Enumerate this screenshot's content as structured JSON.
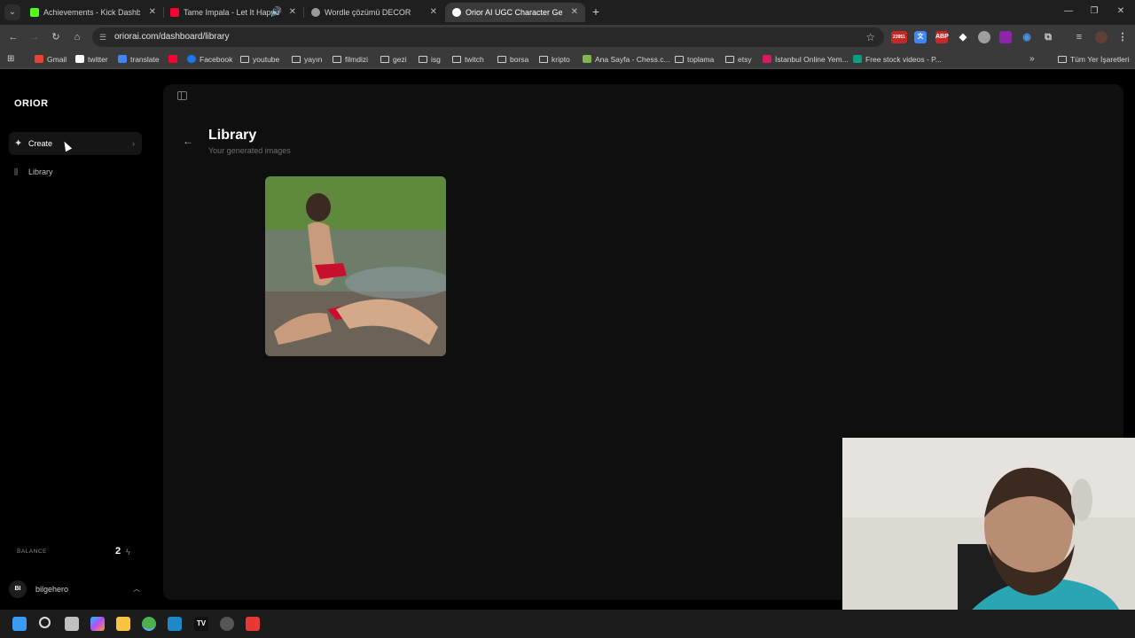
{
  "browser": {
    "tabs": [
      {
        "title": "Achievements - Kick Dashboard",
        "favicon_color": "#53fc18",
        "active": false
      },
      {
        "title": "Tame Impala - Let It Happen",
        "favicon_color": "#ff0033",
        "active": false
      },
      {
        "title": "Wordle çözümü DECOR",
        "favicon_color": "#9a9a9a",
        "active": false
      },
      {
        "title": "Orior AI UGC Character Generator",
        "favicon_color": "#ffffff",
        "active": true
      }
    ],
    "url": "oriorai.com/dashboard/library",
    "extension_badge": "23951",
    "extensions": [
      "red-badge-ext",
      "translate-ext",
      "abp-ext",
      "diamond-ext",
      "face-ext",
      "purple-ext",
      "speech-ext",
      "puzzle-ext"
    ],
    "bookmarks": [
      {
        "label": "Gmail",
        "icon": "gmail-icon",
        "color": "#ea4335"
      },
      {
        "label": "twitter",
        "icon": "x-icon",
        "color": "#ffffff"
      },
      {
        "label": "translate",
        "icon": "translate-icon",
        "color": "#4285f4"
      },
      {
        "label": "",
        "icon": "youtube-icon",
        "color": "#ff0033"
      },
      {
        "label": "Facebook",
        "icon": "facebook-icon",
        "color": "#1877f2"
      },
      {
        "label": "youtube",
        "icon": "folder-icon"
      },
      {
        "label": "yayın",
        "icon": "folder-icon"
      },
      {
        "label": "filmdizi",
        "icon": "folder-icon"
      },
      {
        "label": "gezi",
        "icon": "folder-icon"
      },
      {
        "label": "isg",
        "icon": "folder-icon"
      },
      {
        "label": "twitch",
        "icon": "folder-icon"
      },
      {
        "label": "borsa",
        "icon": "folder-icon"
      },
      {
        "label": "kripto",
        "icon": "folder-icon"
      },
      {
        "label": "Ana Sayfa - Chess.c...",
        "icon": "chess-icon",
        "color": "#81b64c"
      },
      {
        "label": "toplama",
        "icon": "folder-icon"
      },
      {
        "label": "etsy",
        "icon": "folder-icon"
      },
      {
        "label": "İstanbul Online Yem...",
        "icon": "yemek-icon",
        "color": "#d81b60"
      },
      {
        "label": "Free stock videos - P...",
        "icon": "pexels-icon",
        "color": "#05a081"
      }
    ],
    "all_bookmarks": "Tüm Yer İşaretleri"
  },
  "sidebar": {
    "logo": "ORIOR",
    "create_label": "Create",
    "library_label": "Library",
    "balance_label": "BALANCE",
    "balance_value": "2",
    "user_initials": "BI",
    "username": "bilgehero"
  },
  "main": {
    "title": "Library",
    "subtitle": "Your generated images"
  }
}
